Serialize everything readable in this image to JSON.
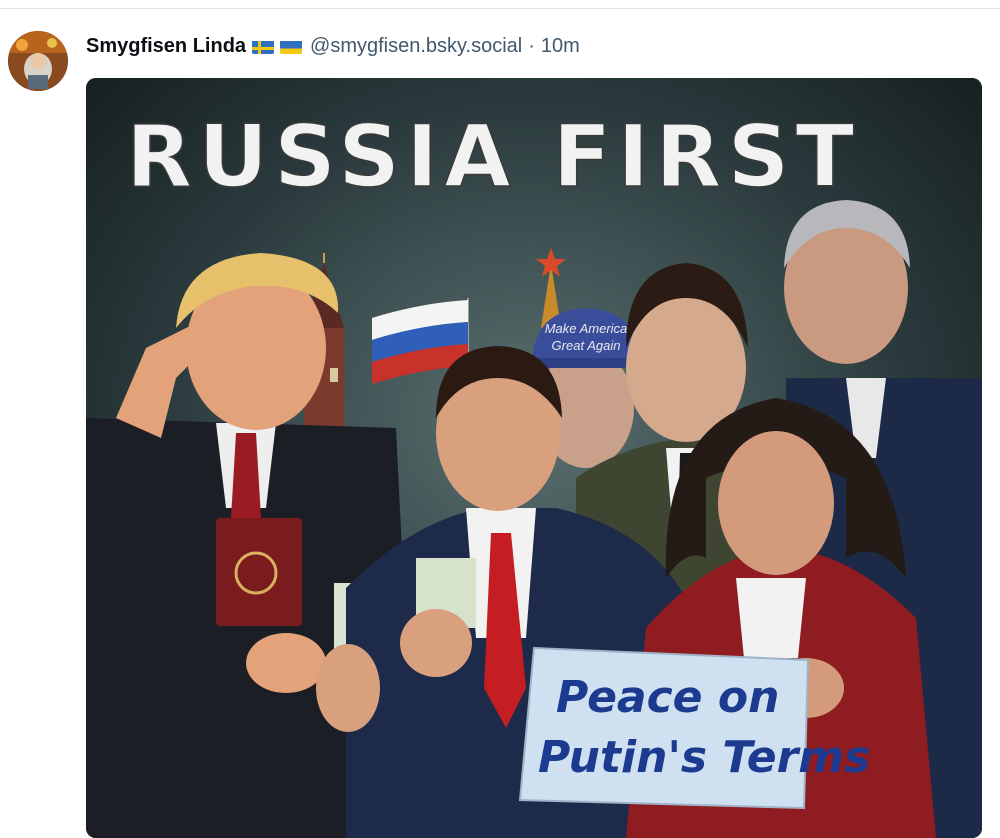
{
  "post": {
    "author_name": "Smygfisen Linda",
    "flags": [
      "sweden-flag-icon",
      "ukraine-flag-icon"
    ],
    "handle": "@smygfisen.bsky.social",
    "separator": "·",
    "timestamp": "10m"
  },
  "image": {
    "headline": "RUSSIA FIRST",
    "sign_line1": "Peace on",
    "sign_line2": "Putin's Terms",
    "cap_line1": "Make America",
    "cap_line2": "Great Again"
  },
  "colors": {
    "handle": "#42576c",
    "divider": "#dfe3e8",
    "sign_text": "#1c3a8f",
    "sign_bg": "#cfe0f0"
  }
}
